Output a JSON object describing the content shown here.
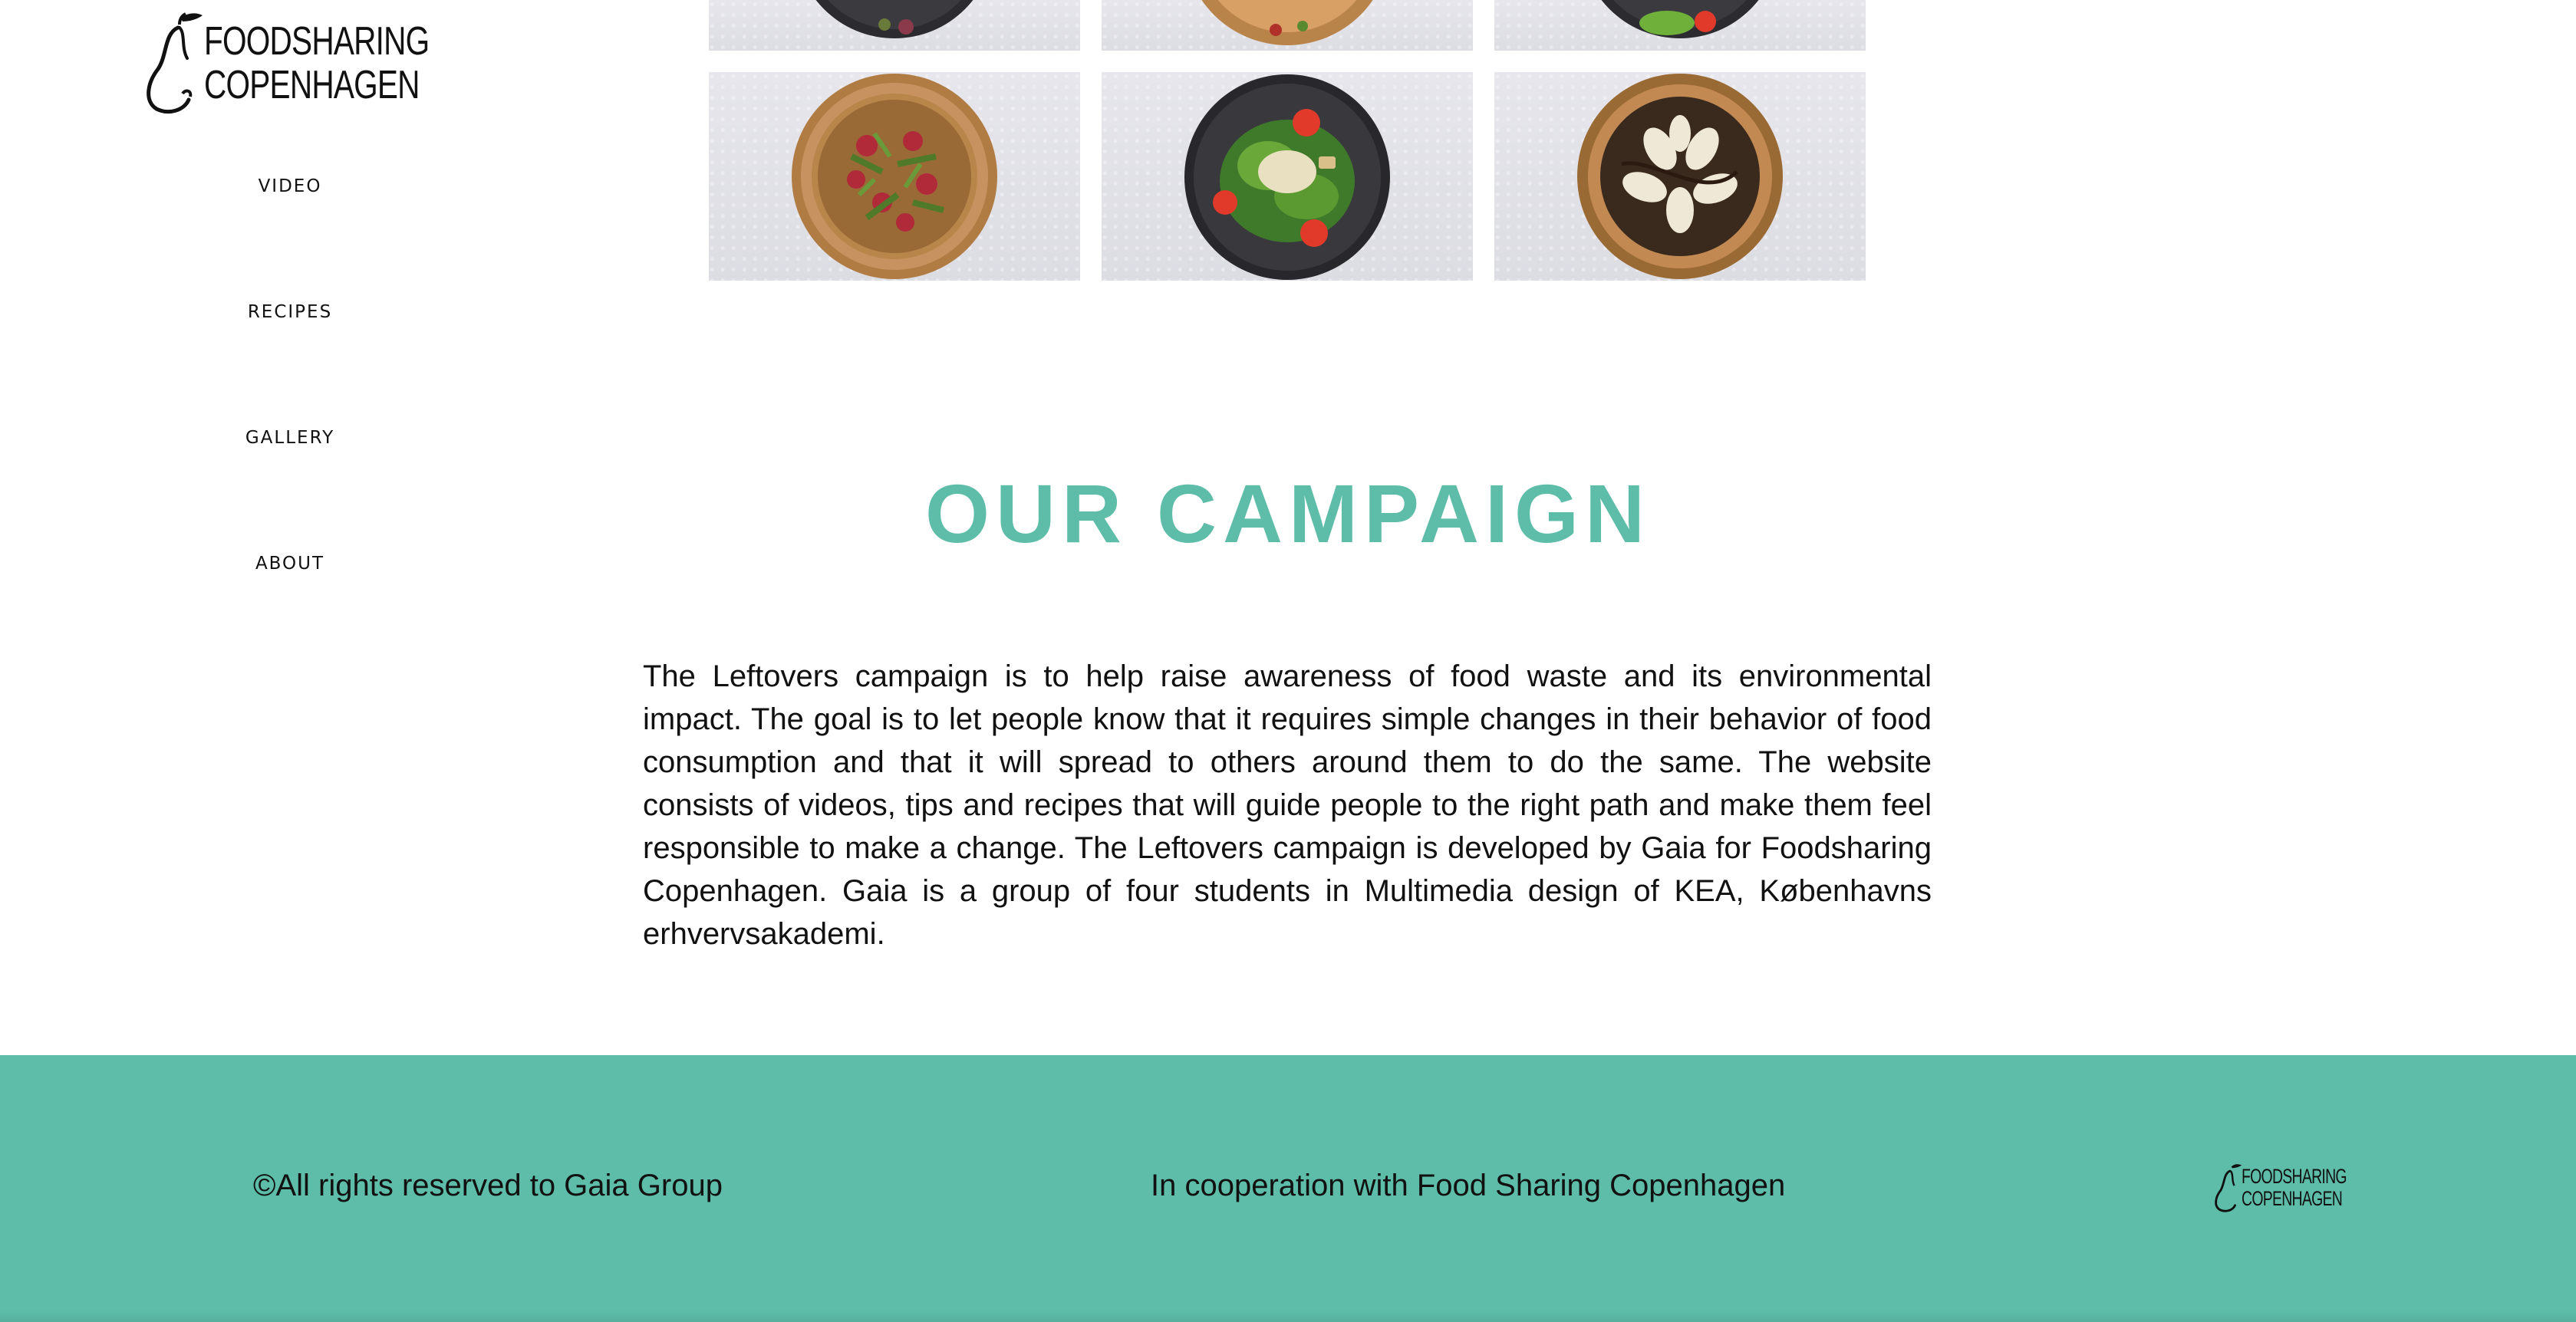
{
  "logo": {
    "line1": "FOODSHARING",
    "line2": "COPENHAGEN"
  },
  "nav": {
    "items": [
      {
        "label": "VIDEO"
      },
      {
        "label": "RECIPES"
      },
      {
        "label": "GALLERY"
      },
      {
        "label": "ABOUT"
      }
    ]
  },
  "gallery": {
    "tiles": [
      {
        "icon": "salad-plate-icon"
      },
      {
        "icon": "pizza-icon"
      },
      {
        "icon": "salad-plate-icon"
      },
      {
        "icon": "pizza-icon"
      },
      {
        "icon": "caesar-salad-icon"
      },
      {
        "icon": "banana-pizza-icon"
      }
    ]
  },
  "campaign": {
    "title": "OUR CAMPAIGN",
    "body": "The Leftovers campaign is to help raise awareness of food waste and its environmental impact. The goal is to let people know that it requires simple changes in their behavior of food consumption and that it will spread to others around them to do the same. The website consists of videos, tips and recipes that will guide people to the right path and make them feel responsible to make a change. The Leftovers campaign is developed by Gaia for Foodsharing Copenhagen. Gaia is a group of four students in Multimedia design of KEA, Københavns erhvervsakademi."
  },
  "footer": {
    "copyright": "©All rights reserved to Gaia Group",
    "cooperation": "In cooperation with Food Sharing Copenhagen",
    "logo": {
      "line1": "FOODSHARING",
      "line2": "COPENHAGEN"
    }
  },
  "colors": {
    "accent": "#5dbda9",
    "text": "#111111",
    "tile_bg": "#e2e2e8"
  }
}
